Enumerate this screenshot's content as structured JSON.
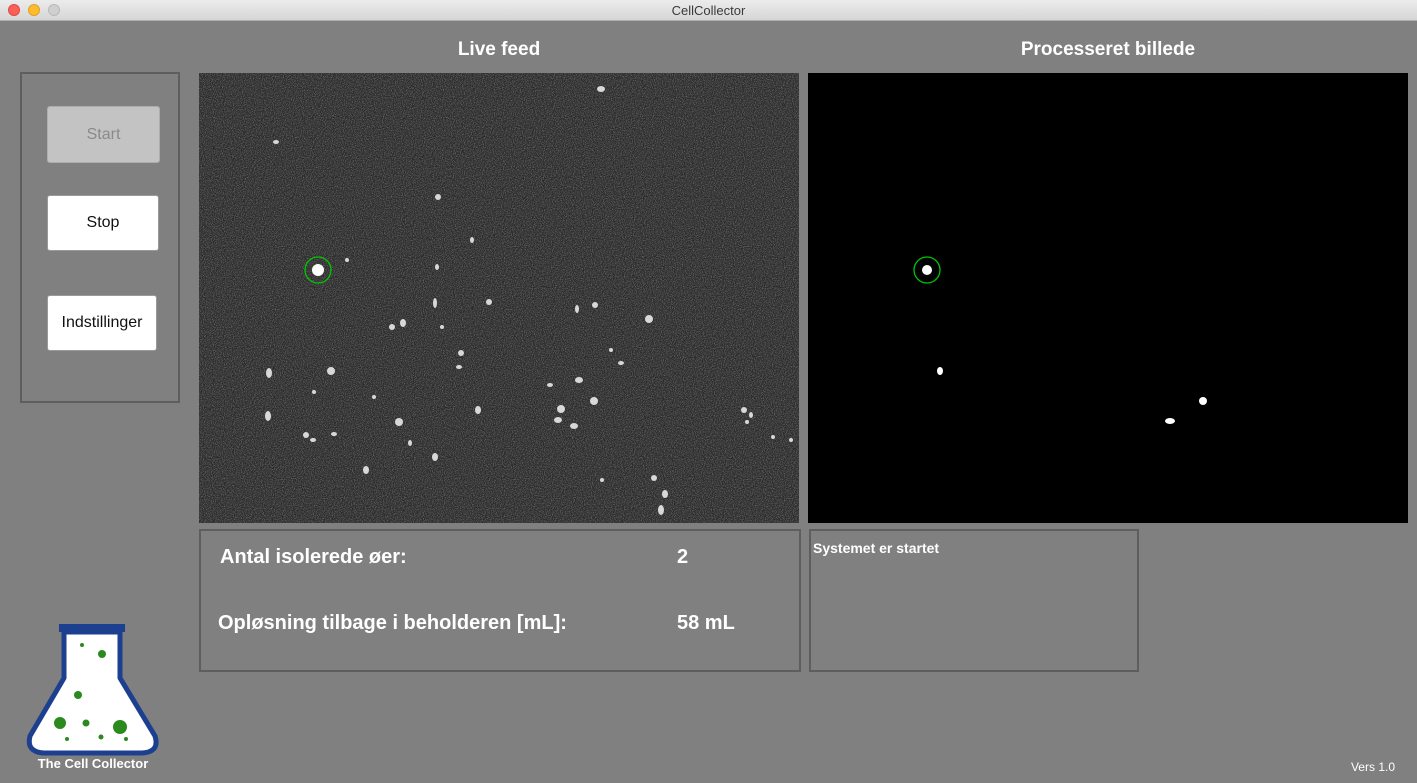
{
  "window": {
    "title": "CellCollector"
  },
  "controls": {
    "start_label": "Start",
    "stop_label": "Stop",
    "settings_label": "Indstillinger"
  },
  "live_feed": {
    "title": "Live feed"
  },
  "processed": {
    "title": "Processeret billede"
  },
  "info": {
    "islands_label": "Antal isolerede øer:",
    "islands_value": "2",
    "solution_label": "Opløsning tilbage i beholderen [mL]:",
    "solution_value": "58 mL"
  },
  "status": {
    "message": "Systemet er startet"
  },
  "branding": {
    "logo_name": "The Cell Collector",
    "version": "Vers 1.0"
  },
  "colors": {
    "background": "#808080",
    "highlight_circle": "#00c800",
    "logo_blue": "#1c3f8f",
    "logo_liquid": "#2a8a1e"
  }
}
